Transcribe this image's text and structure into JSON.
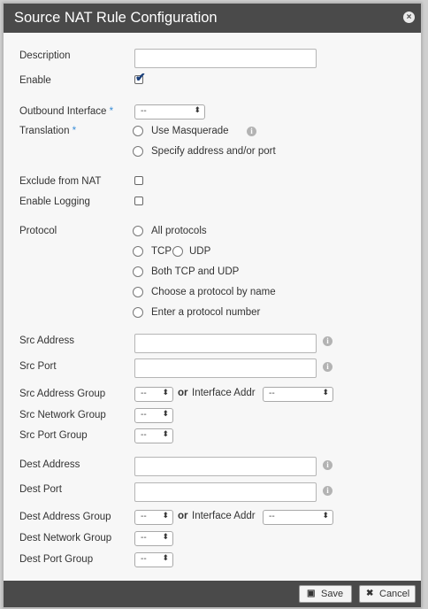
{
  "dialog": {
    "title": "Source NAT Rule Configuration",
    "close_icon": "close-icon"
  },
  "fields": {
    "description": "Description",
    "enable": "Enable",
    "enable_checked": true,
    "outbound_interface": "Outbound Interface",
    "required_mark": "*",
    "translation": "Translation",
    "exclude_from_nat": "Exclude from NAT",
    "enable_logging": "Enable Logging",
    "protocol": "Protocol",
    "src_address": "Src Address",
    "src_port": "Src Port",
    "src_address_group": "Src Address Group",
    "src_network_group": "Src Network Group",
    "src_port_group": "Src Port Group",
    "dest_address": "Dest Address",
    "dest_port": "Dest Port",
    "dest_address_group": "Dest Address Group",
    "dest_network_group": "Dest Network Group",
    "dest_port_group": "Dest Port Group"
  },
  "select_default": "--",
  "or_label": "or",
  "interface_addr_label": "Interface Addr",
  "translation_options": {
    "use_masquerade": "Use Masquerade",
    "specify": "Specify address and/or port"
  },
  "protocol_options": {
    "all": "All protocols",
    "tcp": "TCP",
    "udp": "UDP",
    "both": "Both TCP and UDP",
    "by_name": "Choose a protocol by name",
    "by_number": "Enter a protocol number"
  },
  "footer": {
    "save": "Save",
    "cancel": "Cancel"
  },
  "colors": {
    "titlebar": "#4a4a4a",
    "required": "#3b8ed8",
    "checkmark": "#1a3f7a"
  }
}
